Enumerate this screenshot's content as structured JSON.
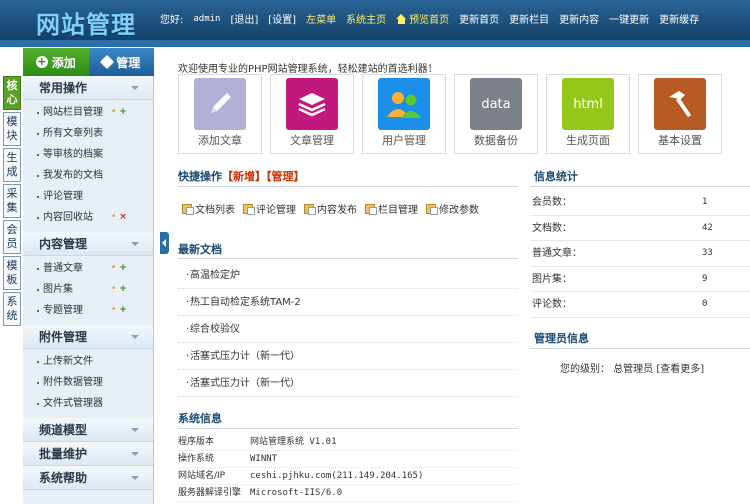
{
  "header": {
    "logo": "网站管理",
    "greeting": "您好:",
    "username": "admin",
    "logout": "[退出]",
    "settings": "[设置]",
    "nav": [
      "左菜单",
      "系统主页"
    ],
    "preview": "预览首页",
    "actions": [
      "更新首页",
      "更新栏目",
      "更新内容",
      "一键更新",
      "更新缓存"
    ]
  },
  "side_tabs": [
    "核心",
    "模块",
    "生成",
    "采集",
    "会员",
    "模板",
    "系统"
  ],
  "side_buttons": {
    "add": "添加",
    "manage": "管理"
  },
  "sections": [
    {
      "title": "常用操作",
      "items": [
        "网站栏目管理",
        "所有文章列表",
        "等审核的档案",
        "我发布的文档",
        "评论管理",
        "内容回收站"
      ]
    },
    {
      "title": "内容管理",
      "items": [
        "普通文章",
        "图片集",
        "专题管理"
      ]
    },
    {
      "title": "附件管理",
      "items": [
        "上传新文件",
        "附件数据管理",
        "文件式管理器"
      ]
    },
    {
      "title": "频道模型"
    },
    {
      "title": "批量维护"
    },
    {
      "title": "系统帮助"
    }
  ],
  "welcome": "欢迎使用专业的PHP网站管理系统，轻松建站的首选利器！",
  "shortcuts": [
    {
      "label": "添加文章",
      "color": "#b3b0d8"
    },
    {
      "label": "文章管理",
      "color": "#c0187c"
    },
    {
      "label": "用户管理",
      "color": "#1a8ee8"
    },
    {
      "label": "数据备份",
      "text": "data",
      "color": "#7c8088"
    },
    {
      "label": "生成页面",
      "text": "html",
      "color": "#94c818"
    },
    {
      "label": "基本设置",
      "color": "#b85a24"
    }
  ],
  "quick": {
    "title": "快捷操作",
    "add": "【新增】",
    "manage": "【管理】",
    "items": [
      "文档列表",
      "评论管理",
      "内容发布",
      "栏目管理",
      "修改参数"
    ]
  },
  "latest": {
    "title": "最新文档",
    "items": [
      "高温检定炉",
      "热工自动检定系统TAM-2",
      "综合校验仪",
      "活塞式压力计（新一代）",
      "活塞式压力计（新一代）"
    ]
  },
  "sysinfo": {
    "title": "系统信息",
    "rows": [
      {
        "k": "程序版本",
        "v": "网站管理系统 V1.01"
      },
      {
        "k": "操作系统",
        "v": "WINNT"
      },
      {
        "k": "网站域名/IP",
        "v": "ceshi.pjhku.com(211.149.204.165)"
      },
      {
        "k": "服务器解译引擎",
        "v": "Microsoft-IIS/6.0"
      }
    ]
  },
  "stats": {
    "title": "信息统计",
    "rows": [
      {
        "k": "会员数：",
        "v": "1"
      },
      {
        "k": "文档数：",
        "v": "42"
      },
      {
        "k": "普通文章：",
        "v": "33"
      },
      {
        "k": "图片集：",
        "v": "9"
      },
      {
        "k": "评论数：",
        "v": "0"
      }
    ]
  },
  "admin": {
    "title": "管理员信息",
    "level_label": "您的级别：",
    "level_value": "总管理员",
    "more": "[查看更多]"
  }
}
